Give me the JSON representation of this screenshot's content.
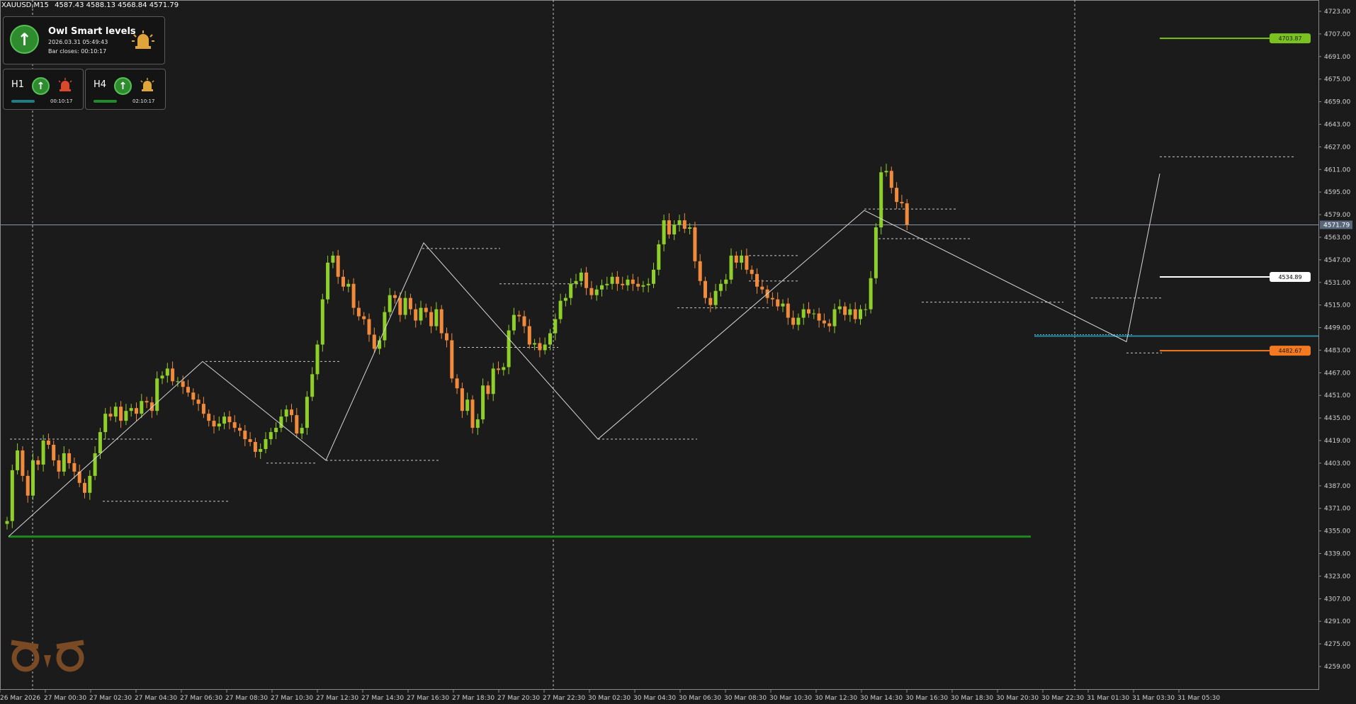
{
  "header": {
    "symbol": "XAUUSD,M15",
    "ohlc": "4587.43 4588.13 4568.84 4571.79"
  },
  "indicator_panel": {
    "title": "Owl Smart levels",
    "datetime": "2026.03.31 05:49:43",
    "bar_closes": "Bar closes: 00:10:17",
    "main_arrow": "up-arrow-icon",
    "alarm_icon": "alarm-lamp-icon"
  },
  "mini_panels": [
    {
      "label": "H1",
      "timer": "00:10:17",
      "bar_color": "#1f7d86",
      "lamp_color": "#d94a2a"
    },
    {
      "label": "H4",
      "timer": "02:10:17",
      "bar_color": "#1e8c2a",
      "lamp_color": "#e0a53a"
    }
  ],
  "colors": {
    "background": "#1b1b1b",
    "bull": "#8fcf2a",
    "bear": "#f28a3c",
    "level_green": "#7ac21f",
    "level_orange": "#f37a21",
    "level_white": "#ffffff",
    "support_green": "#1c8a1c",
    "cyan_line": "#2a8aa0"
  },
  "price_axis": {
    "labels": [
      "4723.00",
      "4707.00",
      "4691.00",
      "4675.00",
      "4659.00",
      "4643.00",
      "4627.00",
      "4611.00",
      "4595.00",
      "4579.00",
      "4563.00",
      "4547.00",
      "4531.00",
      "4515.00",
      "4499.00",
      "4483.00",
      "4467.00",
      "4451.00",
      "4435.00",
      "4419.00",
      "4403.00",
      "4387.00",
      "4371.00",
      "4355.00",
      "4339.00",
      "4323.00",
      "4307.00",
      "4291.00",
      "4275.00",
      "4259.00"
    ],
    "current_price": "4571.79"
  },
  "time_axis": {
    "labels": [
      "26 Mar 2026",
      "27 Mar 00:30",
      "27 Mar 02:30",
      "27 Mar 04:30",
      "27 Mar 06:30",
      "27 Mar 08:30",
      "27 Mar 10:30",
      "27 Mar 12:30",
      "27 Mar 14:30",
      "27 Mar 16:30",
      "27 Mar 18:30",
      "27 Mar 20:30",
      "27 Mar 22:30",
      "30 Mar 02:30",
      "30 Mar 04:30",
      "30 Mar 06:30",
      "30 Mar 08:30",
      "30 Mar 10:30",
      "30 Mar 12:30",
      "30 Mar 14:30",
      "30 Mar 16:30",
      "30 Mar 18:30",
      "30 Mar 20:30",
      "30 Mar 22:30",
      "31 Mar 01:30",
      "31 Mar 03:30",
      "31 Mar 05:30"
    ]
  },
  "levels": [
    {
      "name": "target-level-green",
      "price": 4703.87,
      "label": "4703.87",
      "color": "#7ac21f"
    },
    {
      "name": "entry-level-white",
      "price": 4534.89,
      "label": "4534.89",
      "color": "#ffffff"
    },
    {
      "name": "stop-level-orange",
      "price": 4482.67,
      "label": "4482.67",
      "color": "#f37a21"
    }
  ],
  "chart_data": {
    "type": "candlestick",
    "symbol": "XAUUSD",
    "timeframe": "M15",
    "ylim": [
      4245,
      4727
    ],
    "support_line": 4351,
    "cyan_level": 4493,
    "current_price": 4571.79,
    "zigzag": [
      4351,
      4475,
      4405,
      4559,
      4420,
      4582,
      4489,
      4608
    ],
    "candles_close": [
      4362,
      4398,
      4412,
      4394,
      4380,
      4405,
      4402,
      4419,
      4416,
      4405,
      4397,
      4410,
      4403,
      4397,
      4389,
      4382,
      4394,
      4410,
      4425,
      4438,
      4436,
      4443,
      4433,
      4440,
      4442,
      4438,
      4447,
      4446,
      4440,
      4463,
      4465,
      4470,
      4461,
      4461,
      4457,
      4453,
      4448,
      4445,
      4438,
      4433,
      4429,
      4431,
      4436,
      4432,
      4428,
      4426,
      4420,
      4418,
      4411,
      4413,
      4420,
      4425,
      4428,
      4436,
      4441,
      4437,
      4424,
      4428,
      4450,
      4466,
      4487,
      4519,
      4545,
      4550,
      4535,
      4528,
      4530,
      4513,
      4507,
      4505,
      4494,
      4484,
      4490,
      4510,
      4522,
      4520,
      4508,
      4520,
      4512,
      4504,
      4513,
      4510,
      4500,
      4512,
      4495,
      4490,
      4463,
      4456,
      4440,
      4448,
      4428,
      4434,
      4458,
      4452,
      4470,
      4469,
      4471,
      4497,
      4508,
      4507,
      4500,
      4487,
      4488,
      4483,
      4487,
      4495,
      4505,
      4518,
      4520,
      4530,
      4532,
      4538,
      4527,
      4522,
      4526,
      4529,
      4530,
      4535,
      4530,
      4529,
      4533,
      4530,
      4528,
      4529,
      4530,
      4540,
      4558,
      4575,
      4565,
      4572,
      4575,
      4569,
      4570,
      4546,
      4532,
      4520,
      4515,
      4525,
      4530,
      4533,
      4550,
      4545,
      4550,
      4540,
      4537,
      4528,
      4526,
      4520,
      4519,
      4514,
      4516,
      4506,
      4501,
      4506,
      4512,
      4509,
      4509,
      4504,
      4502,
      4500,
      4512,
      4514,
      4508,
      4512,
      4505,
      4512,
      4512,
      4534,
      4570,
      4609,
      4610,
      4598,
      4588,
      4587,
      4572
    ]
  }
}
